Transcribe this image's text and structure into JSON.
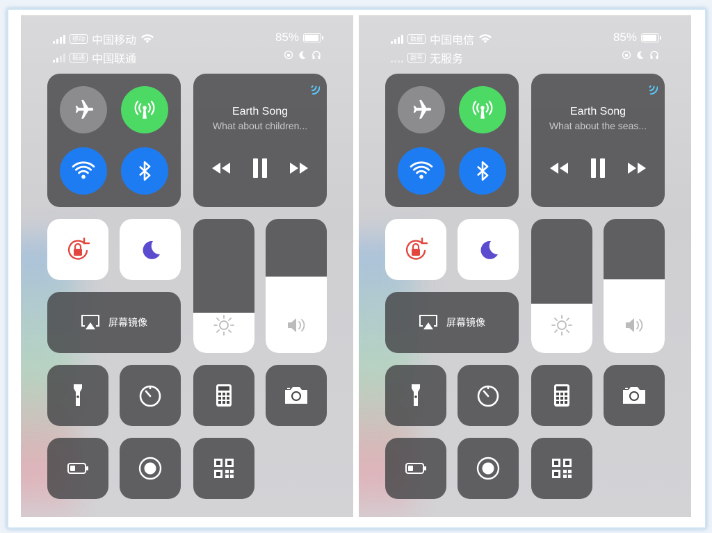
{
  "screens": [
    {
      "sim1": {
        "tag": "移动",
        "carrier": "中国移动"
      },
      "sim2": {
        "tag": "联通",
        "carrier": "中国联通"
      },
      "battery_percent": "85%",
      "music": {
        "title": "Earth Song",
        "subtitle": "What about children..."
      },
      "mirror_label": "屏幕镜像",
      "brightness_level": 0.3,
      "volume_level": 0.57
    },
    {
      "sim1": {
        "tag": "数据",
        "carrier": "中国电信"
      },
      "sim2": {
        "tag": "副号",
        "carrier": "无服务"
      },
      "battery_percent": "85%",
      "music": {
        "title": "Earth Song",
        "subtitle": "What about the seas..."
      },
      "mirror_label": "屏幕镜像",
      "brightness_level": 0.37,
      "volume_level": 0.55
    }
  ],
  "icons": [
    "airplane-icon",
    "cellular-icon",
    "wifi-icon",
    "bluetooth-icon",
    "airplay-icon",
    "rewind-icon",
    "pause-icon",
    "fast-forward-icon",
    "rotation-lock-icon",
    "moon-icon",
    "screen-mirror-icon",
    "brightness-icon",
    "volume-icon",
    "flashlight-icon",
    "timer-icon",
    "calculator-icon",
    "camera-icon",
    "low-power-icon",
    "screen-record-icon",
    "qr-code-icon"
  ],
  "colors": {
    "green": "#4cd964",
    "blue": "#1e7cf2",
    "red": "#e2473f",
    "purple": "#5b4ccf",
    "tile": "#464648"
  }
}
